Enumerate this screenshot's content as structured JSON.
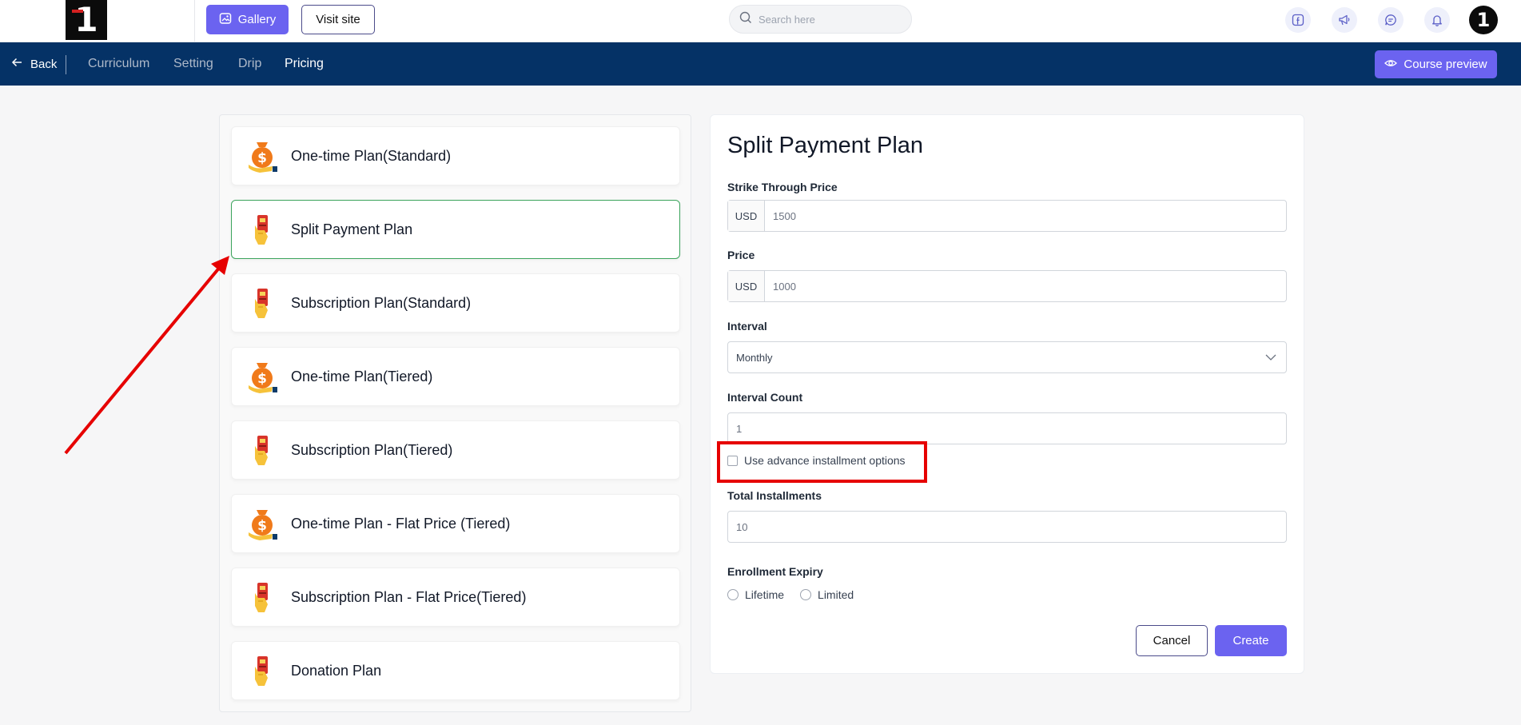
{
  "topbar": {
    "logo_text": "1",
    "gallery_label": "Gallery",
    "visit_site_label": "Visit site",
    "search_placeholder": "Search here",
    "avatar_text": "1",
    "icons": [
      "facebook-icon",
      "megaphone-icon",
      "chat-icon",
      "bell-icon"
    ]
  },
  "navbar": {
    "back_label": "Back",
    "tabs": [
      {
        "label": "Curriculum",
        "active": false
      },
      {
        "label": "Setting",
        "active": false
      },
      {
        "label": "Drip",
        "active": false
      },
      {
        "label": "Pricing",
        "active": true
      }
    ],
    "preview_label": "Course preview"
  },
  "plans": [
    {
      "label": "One-time Plan(Standard)",
      "icon": "money-bag-icon",
      "selected": false
    },
    {
      "label": "Split Payment Plan",
      "icon": "card-hand-icon",
      "selected": true
    },
    {
      "label": "Subscription Plan(Standard)",
      "icon": "card-hand-icon",
      "selected": false
    },
    {
      "label": "One-time Plan(Tiered)",
      "icon": "money-bag-icon",
      "selected": false
    },
    {
      "label": "Subscription Plan(Tiered)",
      "icon": "card-hand-icon",
      "selected": false
    },
    {
      "label": "One-time Plan - Flat Price (Tiered)",
      "icon": "money-bag-icon",
      "selected": false
    },
    {
      "label": "Subscription Plan - Flat Price(Tiered)",
      "icon": "card-hand-icon",
      "selected": false
    },
    {
      "label": "Donation Plan",
      "icon": "card-hand-icon",
      "selected": false
    }
  ],
  "form": {
    "title": "Split Payment Plan",
    "strike_label": "Strike Through Price",
    "strike_currency": "USD",
    "strike_value": "1500",
    "price_label": "Price",
    "price_currency": "USD",
    "price_value": "1000",
    "interval_label": "Interval",
    "interval_value": "Monthly",
    "interval_count_label": "Interval Count",
    "interval_count_value": "1",
    "advance_label": "Use advance installment options",
    "advance_checked": false,
    "total_label": "Total Installments",
    "total_value": "10",
    "expiry_label": "Enrollment Expiry",
    "expiry_options": [
      "Lifetime",
      "Limited"
    ],
    "cancel_label": "Cancel",
    "create_label": "Create"
  },
  "colors": {
    "brand": "#6b63f0",
    "navbar": "#053266",
    "selected_border": "#3aa35b",
    "annotation": "#e60000"
  }
}
